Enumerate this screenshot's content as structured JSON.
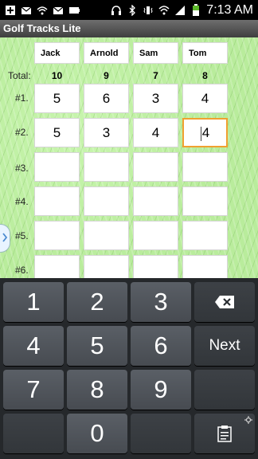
{
  "status": {
    "time": "7:13 AM"
  },
  "app": {
    "title": "Golf Tracks Lite"
  },
  "players": [
    "Jack",
    "Arnold",
    "Sam",
    "Tom"
  ],
  "totals": {
    "label": "Total:",
    "values": [
      "10",
      "9",
      "7",
      "8"
    ]
  },
  "holes": [
    {
      "label": "#1.",
      "scores": [
        "5",
        "6",
        "3",
        "4"
      ]
    },
    {
      "label": "#2.",
      "scores": [
        "5",
        "3",
        "4",
        "4"
      ]
    },
    {
      "label": "#3.",
      "scores": [
        "",
        "",
        "",
        ""
      ]
    },
    {
      "label": "#4.",
      "scores": [
        "",
        "",
        "",
        ""
      ]
    },
    {
      "label": "#5.",
      "scores": [
        "",
        "",
        "",
        ""
      ]
    },
    {
      "label": "#6.",
      "scores": [
        "",
        "",
        "",
        ""
      ]
    }
  ],
  "keyboard": {
    "row1": [
      "1",
      "2",
      "3"
    ],
    "row2": [
      "4",
      "5",
      "6"
    ],
    "row3": [
      "7",
      "8",
      "9"
    ],
    "row4": [
      "0"
    ],
    "next_label": "Next"
  }
}
